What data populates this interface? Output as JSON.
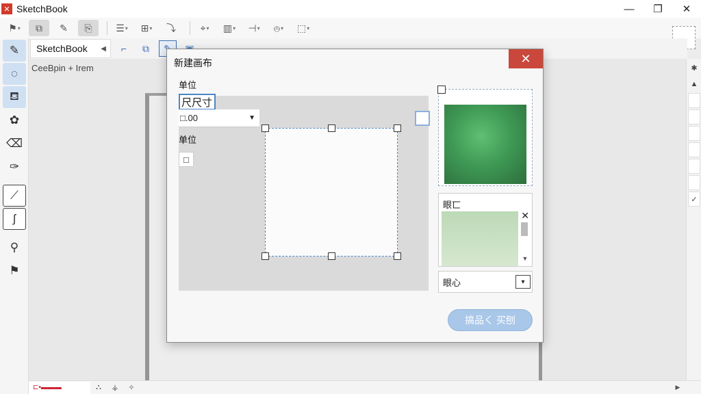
{
  "window": {
    "title": "SketchBook",
    "logo": "sb-logo",
    "minimize_icon": "—",
    "maximize_icon": "❐",
    "close_icon": "✕"
  },
  "toolbar": {
    "items": [
      {
        "name": "flag-tool",
        "glyph": "⚑",
        "has_menu": true,
        "active": false
      },
      {
        "name": "layers-tool",
        "glyph": "⧉",
        "has_menu": false,
        "active": true
      },
      {
        "name": "color-tool",
        "glyph": "✎",
        "has_menu": false,
        "active": false
      },
      {
        "name": "copy-tool",
        "glyph": "⎘",
        "has_menu": false,
        "active": true
      },
      {
        "name": "align-tool",
        "glyph": "☰",
        "has_menu": true,
        "active": false
      },
      {
        "name": "transform-tool",
        "glyph": "⊞",
        "has_menu": true,
        "active": false
      },
      {
        "name": "guide-tool",
        "glyph": "⤵",
        "has_menu": false,
        "active": false
      },
      {
        "name": "perspective-tool",
        "glyph": "⌖",
        "has_menu": true,
        "active": false
      },
      {
        "name": "ruler-tool",
        "glyph": "▥",
        "has_menu": true,
        "active": false
      },
      {
        "name": "symmetry-tool",
        "glyph": "⊣",
        "has_menu": true,
        "active": false
      },
      {
        "name": "snap-tool",
        "glyph": "⦺",
        "has_menu": true,
        "active": false
      },
      {
        "name": "predict-tool",
        "glyph": "⬚",
        "has_menu": true,
        "active": false
      }
    ]
  },
  "toolbar2": {
    "doc_tab": "SketchBook",
    "tab_arrow": "◀",
    "buttons": [
      {
        "name": "crop-tool",
        "glyph": "⌐",
        "active": false
      },
      {
        "name": "layer-tool",
        "glyph": "⧉",
        "active": false
      },
      {
        "name": "edit-tool",
        "glyph": "✎",
        "active": true
      },
      {
        "name": "canvas-tool",
        "glyph": "▣",
        "active": false
      }
    ]
  },
  "left_tools": [
    {
      "name": "pencil-tool",
      "glyph": "✎",
      "state": "active"
    },
    {
      "name": "lasso-tool",
      "glyph": "◌",
      "state": "active"
    },
    {
      "name": "fill-tool",
      "glyph": "⛾",
      "state": "active"
    },
    {
      "name": "brush-tool",
      "glyph": "✿",
      "state": "normal"
    },
    {
      "name": "eraser-tool",
      "glyph": "⌫",
      "state": "normal"
    },
    {
      "name": "dropper-tool",
      "glyph": "✑",
      "state": "normal"
    },
    {
      "name": "stroke-tool",
      "glyph": "⟋",
      "state": "boxed"
    },
    {
      "name": "curve-tool",
      "glyph": "ʃ",
      "state": "boxed"
    },
    {
      "name": "zoom-tool",
      "glyph": "⚲",
      "state": "normal"
    },
    {
      "name": "flag-tool",
      "glyph": "⚑",
      "state": "normal"
    }
  ],
  "canvas": {
    "label": "CeeBpin + Irem"
  },
  "right_rail": [
    "✱",
    "▲",
    "",
    "",
    "",
    "",
    "",
    "",
    "✓"
  ],
  "bottom_bar": {
    "tab": "⊏▪▬▬▬",
    "icons": [
      "⛬",
      "⚶",
      "✧"
    ],
    "scroll_left": "◀",
    "scroll_right": "▶"
  },
  "dialog": {
    "title": "新建画布",
    "close_icon": "✕",
    "unit_label": "单位",
    "size_value": "尺尺寸",
    "unit_value": "□.00",
    "unit_caret": "▼",
    "unit_label2": "单位",
    "check_glyph": "□",
    "prop_label": "眼匸",
    "prop_close": "✕",
    "select_label": "眼心",
    "select_caret": "▾",
    "ok_button": "搞品く 买刨",
    "swatch_color": "#3f9a55"
  }
}
